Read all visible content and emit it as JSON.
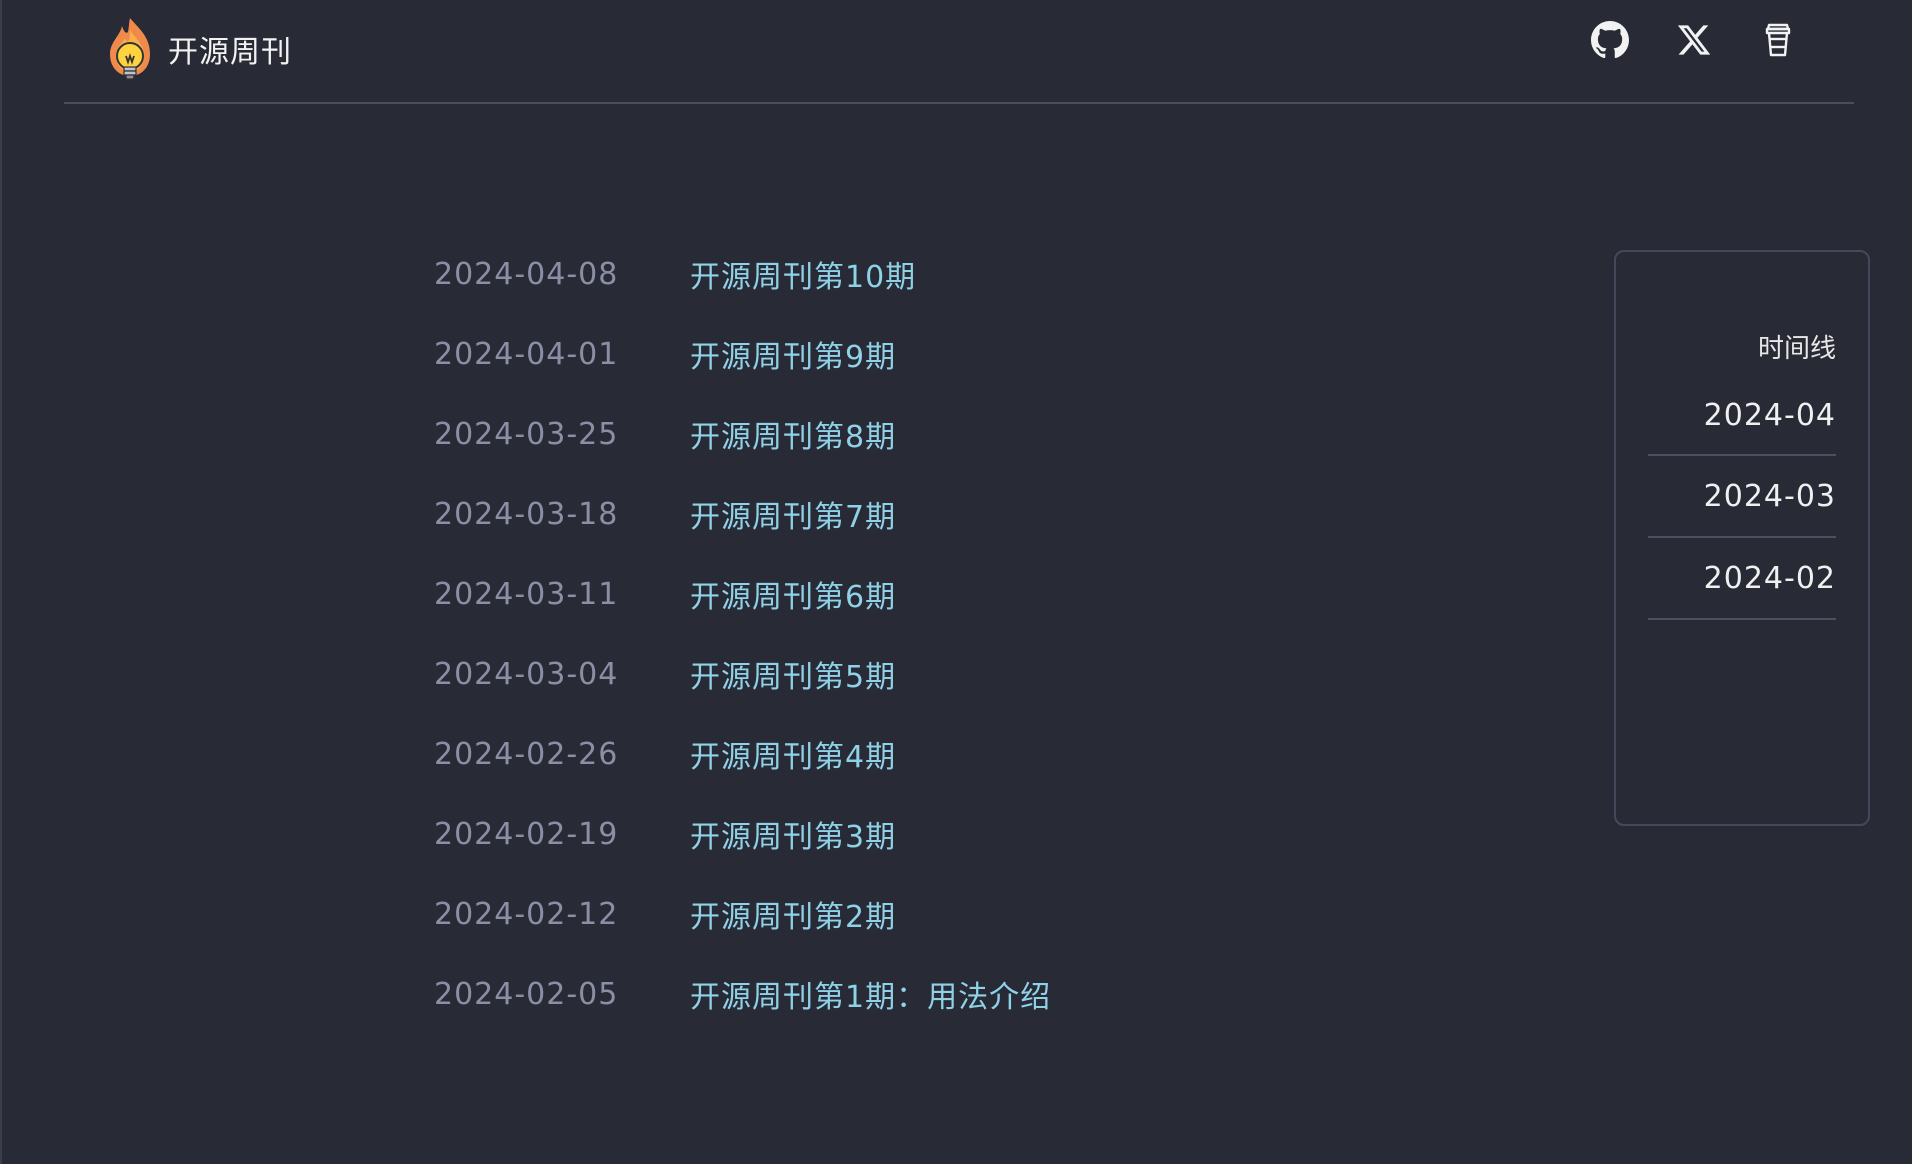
{
  "header": {
    "site_title": "开源周刊",
    "icons": [
      "github-icon",
      "x-icon",
      "coffee-cup-icon"
    ]
  },
  "posts": [
    {
      "date": "2024-04-08",
      "title": "开源周刊第10期"
    },
    {
      "date": "2024-04-01",
      "title": "开源周刊第9期"
    },
    {
      "date": "2024-03-25",
      "title": "开源周刊第8期"
    },
    {
      "date": "2024-03-18",
      "title": "开源周刊第7期"
    },
    {
      "date": "2024-03-11",
      "title": "开源周刊第6期"
    },
    {
      "date": "2024-03-04",
      "title": "开源周刊第5期"
    },
    {
      "date": "2024-02-26",
      "title": "开源周刊第4期"
    },
    {
      "date": "2024-02-19",
      "title": "开源周刊第3期"
    },
    {
      "date": "2024-02-12",
      "title": "开源周刊第2期"
    },
    {
      "date": "2024-02-05",
      "title": "开源周刊第1期：用法介绍"
    }
  ],
  "timeline": {
    "title": "时间线",
    "months": [
      "2024-04",
      "2024-03",
      "2024-02"
    ]
  },
  "colors": {
    "background": "#282a36",
    "date_text": "#8b8fa6",
    "link_text": "#8fd1e6",
    "header_text": "#f2f2f2"
  }
}
